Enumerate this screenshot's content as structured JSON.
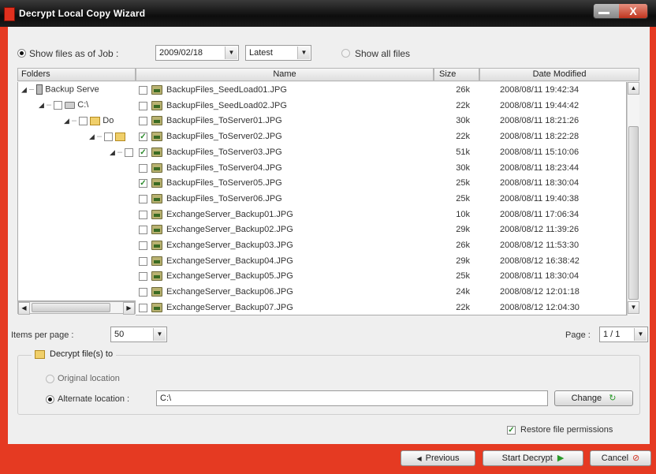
{
  "window": {
    "title": "Decrypt Local Copy Wizard",
    "close_glyph": "X"
  },
  "filter": {
    "show_as_of_job_label": "Show files as of Job :",
    "job_date": "2009/02/18",
    "version": "Latest",
    "show_all_label": "Show all files"
  },
  "columns": {
    "folders": "Folders",
    "name": "Name",
    "size": "Size",
    "date": "Date Modified"
  },
  "tree": {
    "root": "Backup Serve",
    "drive": "C:\\",
    "docs": "Do"
  },
  "files": [
    {
      "name": "BackupFiles_SeedLoad01.JPG",
      "size": "26k",
      "date": "2008/08/11 19:42:34",
      "checked": false
    },
    {
      "name": "BackupFiles_SeedLoad02.JPG",
      "size": "22k",
      "date": "2008/08/11 19:44:42",
      "checked": false
    },
    {
      "name": "BackupFiles_ToServer01.JPG",
      "size": "30k",
      "date": "2008/08/11 18:21:26",
      "checked": false
    },
    {
      "name": "BackupFiles_ToServer02.JPG",
      "size": "22k",
      "date": "2008/08/11 18:22:28",
      "checked": true
    },
    {
      "name": "BackupFiles_ToServer03.JPG",
      "size": "51k",
      "date": "2008/08/11 15:10:06",
      "checked": true
    },
    {
      "name": "BackupFiles_ToServer04.JPG",
      "size": "30k",
      "date": "2008/08/11 18:23:44",
      "checked": false
    },
    {
      "name": "BackupFiles_ToServer05.JPG",
      "size": "25k",
      "date": "2008/08/11 18:30:04",
      "checked": true
    },
    {
      "name": "BackupFiles_ToServer06.JPG",
      "size": "25k",
      "date": "2008/08/11 19:40:38",
      "checked": false
    },
    {
      "name": "ExchangeServer_Backup01.JPG",
      "size": "10k",
      "date": "2008/08/11 17:06:34",
      "checked": false
    },
    {
      "name": "ExchangeServer_Backup02.JPG",
      "size": "29k",
      "date": "2008/08/12 11:39:26",
      "checked": false
    },
    {
      "name": "ExchangeServer_Backup03.JPG",
      "size": "26k",
      "date": "2008/08/12 11:53:30",
      "checked": false
    },
    {
      "name": "ExchangeServer_Backup04.JPG",
      "size": "29k",
      "date": "2008/08/12 16:38:42",
      "checked": false
    },
    {
      "name": "ExchangeServer_Backup05.JPG",
      "size": "25k",
      "date": "2008/08/11 18:30:04",
      "checked": false
    },
    {
      "name": "ExchangeServer_Backup06.JPG",
      "size": "24k",
      "date": "2008/08/12 12:01:18",
      "checked": false
    },
    {
      "name": "ExchangeServer_Backup07.JPG",
      "size": "22k",
      "date": "2008/08/12 12:04:30",
      "checked": false
    }
  ],
  "paging": {
    "items_per_page_label": "Items per page :",
    "items_per_page": "50",
    "page_label": "Page :",
    "page": "1 / 1"
  },
  "decrypt": {
    "group_title": "Decrypt file(s) to",
    "original_label": "Original location",
    "alternate_label": "Alternate location :",
    "alternate_value": "C:\\",
    "change_label": "Change"
  },
  "restore_permissions_label": "Restore file permissions",
  "buttons": {
    "previous": "Previous",
    "start": "Start Decrypt",
    "cancel": "Cancel"
  },
  "colors": {
    "frame": "#e53a22",
    "titlebar": "#111111",
    "check_green": "#2a8a2a"
  }
}
